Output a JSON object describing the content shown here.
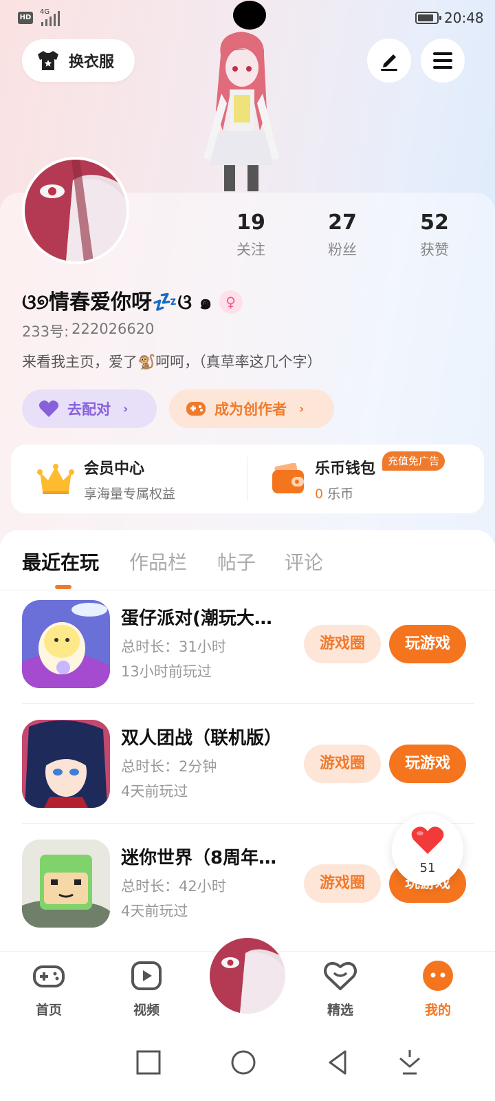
{
  "status_bar": {
    "hd": "HD",
    "network": "4G",
    "time": "20:48"
  },
  "header": {
    "outfit_label": "换衣服",
    "edit_icon": "pen-icon",
    "menu_icon": "menu-icon"
  },
  "profile": {
    "stats": [
      {
        "value": "19",
        "label": "关注"
      },
      {
        "value": "27",
        "label": "粉丝"
      },
      {
        "value": "52",
        "label": "获赞"
      }
    ],
    "nickname": "ଓ୭情春爱你呀💤ଓ ๑",
    "uid_label": "233号:",
    "uid_value": "222026620",
    "bio": "来看我主页，爱了🐒呵呵，（真草率这几个字）",
    "match_label": "去配对",
    "creator_label": "成为创作者"
  },
  "member_card": {
    "vip_title": "会员中心",
    "vip_sub": "享海量专属权益",
    "wallet_title": "乐币钱包",
    "wallet_amount": "0",
    "wallet_unit": "乐币",
    "promo": "充值免广告"
  },
  "tabs": [
    "最近在玩",
    "作品栏",
    "帖子",
    "评论"
  ],
  "games": [
    {
      "title": "蛋仔派对(潮玩大…",
      "duration": "总时长：31小时",
      "last": "13小时前玩过",
      "circle_label": "游戏圈",
      "play_label": "玩游戏"
    },
    {
      "title": "双人团战（联机版）",
      "duration": "总时长：2分钟",
      "last": "4天前玩过",
      "circle_label": "游戏圈",
      "play_label": "玩游戏"
    },
    {
      "title": "迷你世界（8周年…",
      "duration": "总时长：42小时",
      "last": "4天前玩过",
      "circle_label": "游戏圈",
      "play_label": "玩游戏"
    }
  ],
  "like_bubble": {
    "count": "51"
  },
  "bottom_nav": [
    {
      "label": "首页",
      "icon": "gamepad-icon"
    },
    {
      "label": "视频",
      "icon": "video-icon"
    },
    {
      "label": "精选",
      "icon": "heart-chat-icon"
    },
    {
      "label": "我的",
      "icon": "me-icon"
    }
  ],
  "colors": {
    "accent": "#f5741e",
    "purple": "#8860dc"
  }
}
